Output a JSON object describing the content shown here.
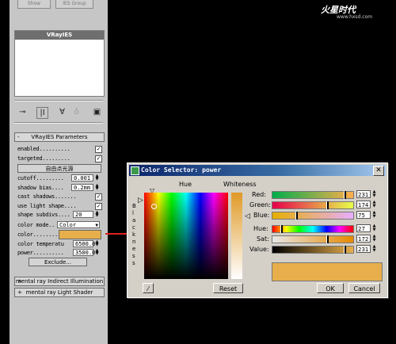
{
  "watermark": {
    "logo": "火星时代",
    "site": "www.hxsd.com"
  },
  "panel": {
    "top_buttons": [
      "Show",
      "IES Group"
    ],
    "list_selected": "VRayIES",
    "rollouts": {
      "params_title": "VRayIES Parameters",
      "mr_indirect": "mental ray Indirect Illumination",
      "mr_light_shader": "mental ray Light Shader",
      "collapse_sign": "-",
      "expand_sign": "+"
    },
    "enabled_label": "enabled..........",
    "targeted_label": "targeted.........",
    "custom_button": "自由点光源",
    "cutoff_label": "cutoff.........",
    "cutoff_value": "0.001",
    "shadow_bias_label": "shadow bias....",
    "shadow_bias_value": "0.2mm",
    "cast_shadows_label": "cast shadows.......",
    "use_light_shape_label": "use light shape....",
    "shape_subdivs_label": "shape subdivs....",
    "shape_subdivs_value": "20",
    "color_mode_label": "color mode..",
    "color_mode_value": "Color",
    "color_label": "color.........",
    "color_temp_label": "color temperatu",
    "color_temp_value": "6500.0",
    "power_label": "power..........",
    "power_value": "3500.0",
    "exclude_button": "Exclude..."
  },
  "dialog": {
    "title": "Color Selector: power",
    "hue_label": "Hue",
    "whiteness_label": "Whiteness",
    "blackness_label": "B l a c k n e s s",
    "channels": [
      {
        "label": "Red:",
        "value": "231"
      },
      {
        "label": "Green:",
        "value": "174"
      },
      {
        "label": "Blue:",
        "value": "75"
      },
      {
        "label": "Hue:",
        "value": "27"
      },
      {
        "label": "Sat:",
        "value": "172"
      },
      {
        "label": "Value:",
        "value": "231"
      }
    ],
    "reset_button": "Reset",
    "ok_button": "OK",
    "cancel_button": "Cancel",
    "current_color": "#e7ae4b"
  }
}
